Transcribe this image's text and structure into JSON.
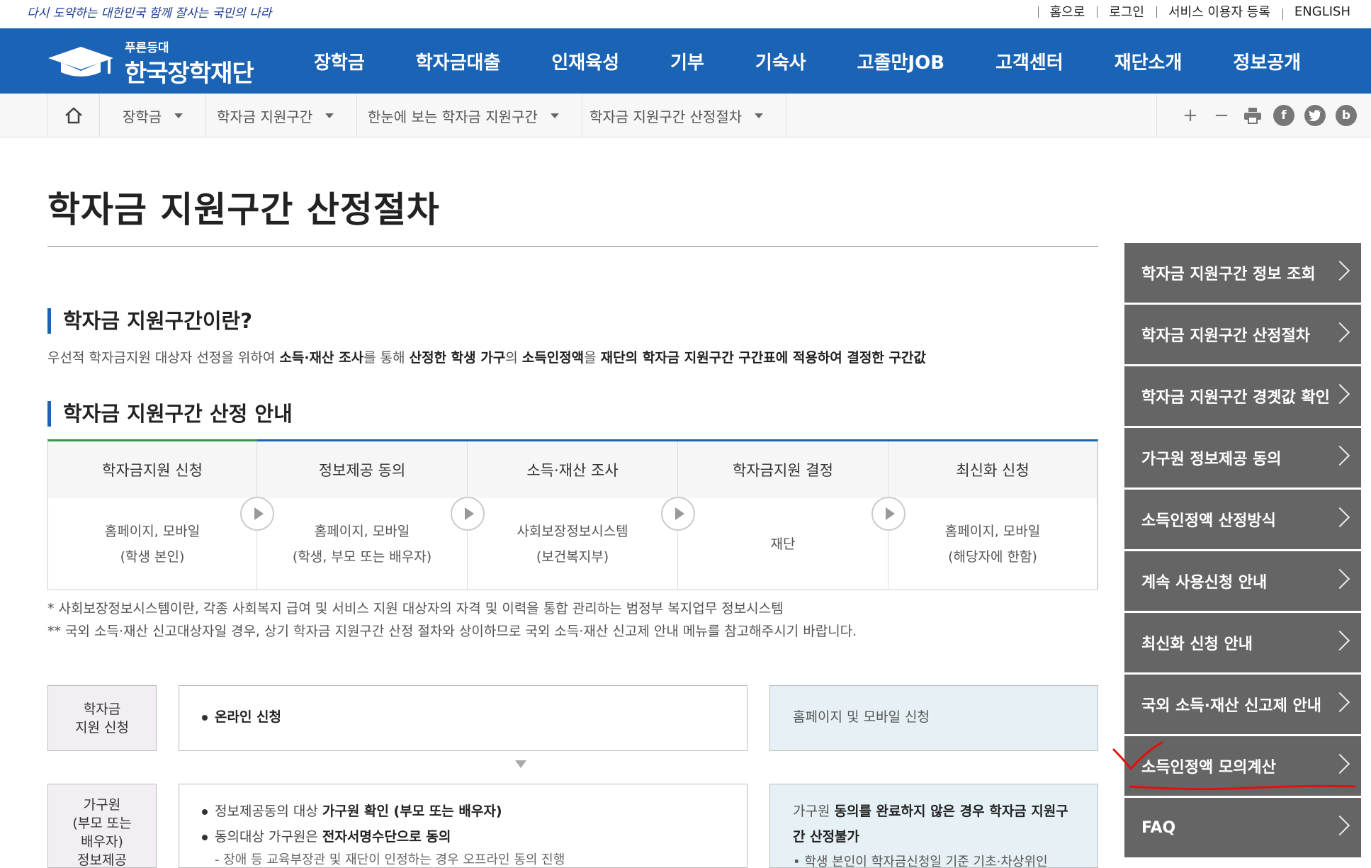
{
  "util": {
    "slogan": "다시 도약하는 대한민국 함께 잘사는 국민의 나라",
    "links": [
      "홈으로",
      "로그인",
      "서비스 이용자 등록",
      "ENGLISH"
    ]
  },
  "brand": {
    "small": "푸른등대",
    "name": "한국장학재단"
  },
  "gnb": [
    "장학금",
    "학자금대출",
    "인재육성",
    "기부",
    "기숙사",
    "고졸만JOB",
    "고객센터",
    "재단소개",
    "정보공개"
  ],
  "breadcrumb": [
    "장학금",
    "학자금 지원구간",
    "한눈에 보는 학자금 지원구간",
    "학자금 지원구간 산정절차"
  ],
  "tools": {
    "zoom_in": "+",
    "zoom_out": "−",
    "facebook": "f",
    "blog": "b"
  },
  "page_title": "학자금 지원구간 산정절차",
  "section1": {
    "heading": "학자금 지원구간이란?",
    "desc_parts": [
      "우선적 학자금지원 대상자 선정을 위하여 ",
      "소득·재산 조사",
      "를 통해 ",
      "산정한 학생 가구",
      "의 ",
      "소득인정액",
      "을 ",
      "재단의 학자금 지원구간 구간표에 적용하여 결정한 구간값"
    ]
  },
  "section2": {
    "heading": "학자금 지원구간 산정 안내",
    "steps": [
      {
        "title": "학자금지원 신청",
        "line1": "홈페이지, 모바일",
        "line2": "(학생 본인)"
      },
      {
        "title": "정보제공 동의",
        "line1": "홈페이지, 모바일",
        "line2": "(학생, 부모 또는 배우자)"
      },
      {
        "title": "소득·재산 조사",
        "line1": "사회보장정보시스템",
        "line2": "(보건복지부)"
      },
      {
        "title": "학자금지원 결정",
        "line1": "재단",
        "line2": ""
      },
      {
        "title": "최신화 신청",
        "line1": "홈페이지, 모바일",
        "line2": "(해당자에 한함)"
      }
    ],
    "notes": [
      "* 사회보장정보시스템이란, 각종 사회복지 급여 및 서비스 지원 대상자의 자격 및 이력을 통합 관리하는 범정부 복지업무 정보시스템",
      "** 국외 소득·재산 신고대상자일 경우, 상기 학자금 지원구간 산정 절차와 상이하므로 국외 소득·재산 신고제 안내 메뉴를 참고해주시기 바랍니다."
    ]
  },
  "rows": [
    {
      "label": [
        "학자금",
        "지원 신청"
      ],
      "mid_item": "온라인 신청",
      "right": "홈페이지 및 모바일 신청"
    },
    {
      "label": [
        "가구원",
        "(부모 또는",
        "배우자)",
        "정보제공"
      ],
      "mid_prefix1": "정보제공동의 대상 ",
      "mid_bold1": "가구원 확인 (부모 또는 배우자)",
      "mid_prefix2": "동의대상 가구원은 ",
      "mid_bold2": "전자서명수단으로 동의",
      "mid_sub": "- 장애 등 교육부장관 및 재단이 인정하는 경우 오프라인 동의 진행",
      "right_prefix": "가구원 ",
      "right_bold": "동의를 완료하지 않은 경우 학자금 지원구간 산정불가",
      "right_sub": "• 학생 본인이 학자금신청일 기준 기초·차상위인"
    }
  ],
  "side_menu": [
    "학자금 지원구간 정보 조회",
    "학자금 지원구간 산정절차",
    "학자금 지원구간 경곗값 확인",
    "가구원 정보제공 동의",
    "소득인정액 산정방식",
    "계속 사용신청 안내",
    "최신화 신청 안내",
    "국외 소득·재산 신고제 안내",
    "소득인정액 모의계산",
    "FAQ"
  ],
  "colors": {
    "brand_blue": "#1b63b5",
    "side_gray": "#656565",
    "annotation_red": "#e01010",
    "step_green": "#2e9a4a"
  }
}
